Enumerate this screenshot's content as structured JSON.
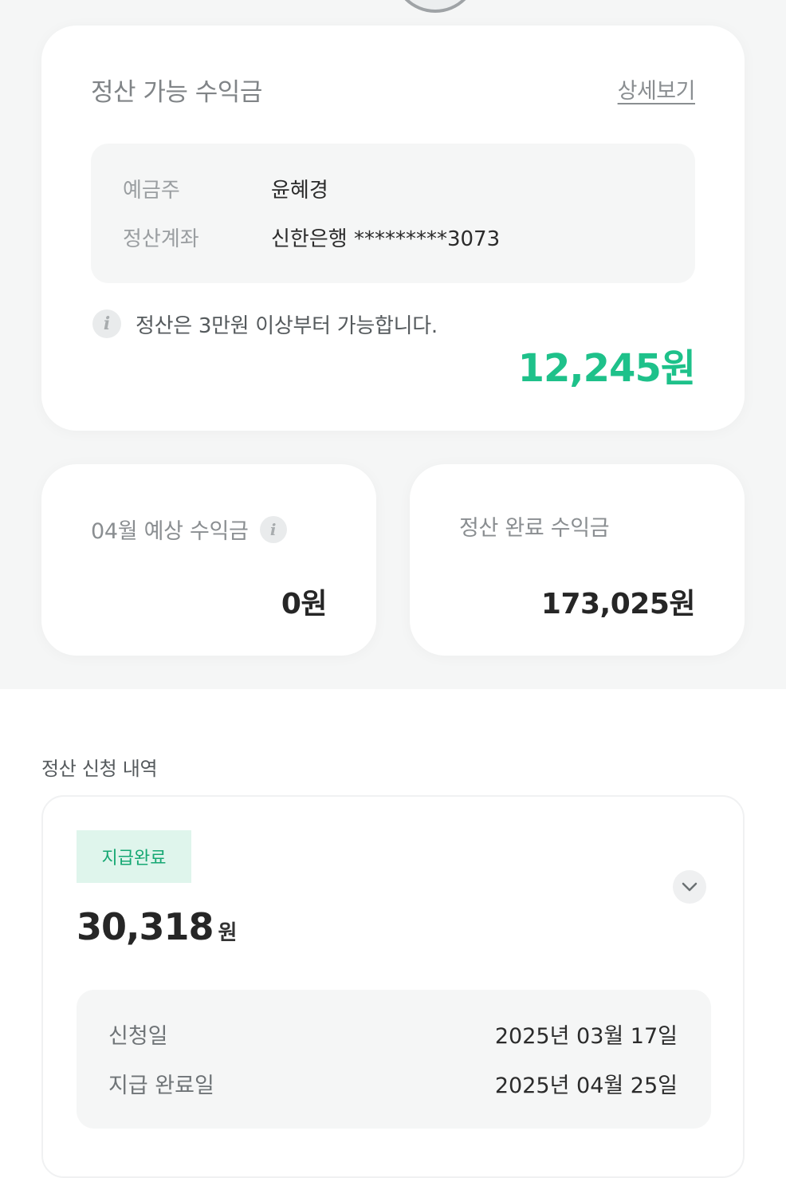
{
  "settlement": {
    "title": "정산 가능 수익금",
    "detail_link": "상세보기",
    "account": {
      "holder_label": "예금주",
      "holder_value": "윤혜경",
      "account_label": "정산계좌",
      "account_value": "신한은행 *********3073"
    },
    "notice": "정산은 3만원 이상부터 가능합니다.",
    "info_icon": "i",
    "amount": "12,245원",
    "amount_color": "#1ec18a"
  },
  "expected": {
    "title": "04월 예상 수익금",
    "info_icon": "i",
    "amount": "0원"
  },
  "completed": {
    "title": "정산 완료 수익금",
    "amount": "173,025원"
  },
  "history": {
    "section_title": "정산 신청 내역",
    "items": [
      {
        "status": "지급완료",
        "status_color": "#16a873",
        "amount": "30,318",
        "unit": "원",
        "request_label": "신청일",
        "request_date": "2025년 03월 17일",
        "paid_label": "지급 완료일",
        "paid_date": "2025년 04월 25일"
      }
    ]
  }
}
